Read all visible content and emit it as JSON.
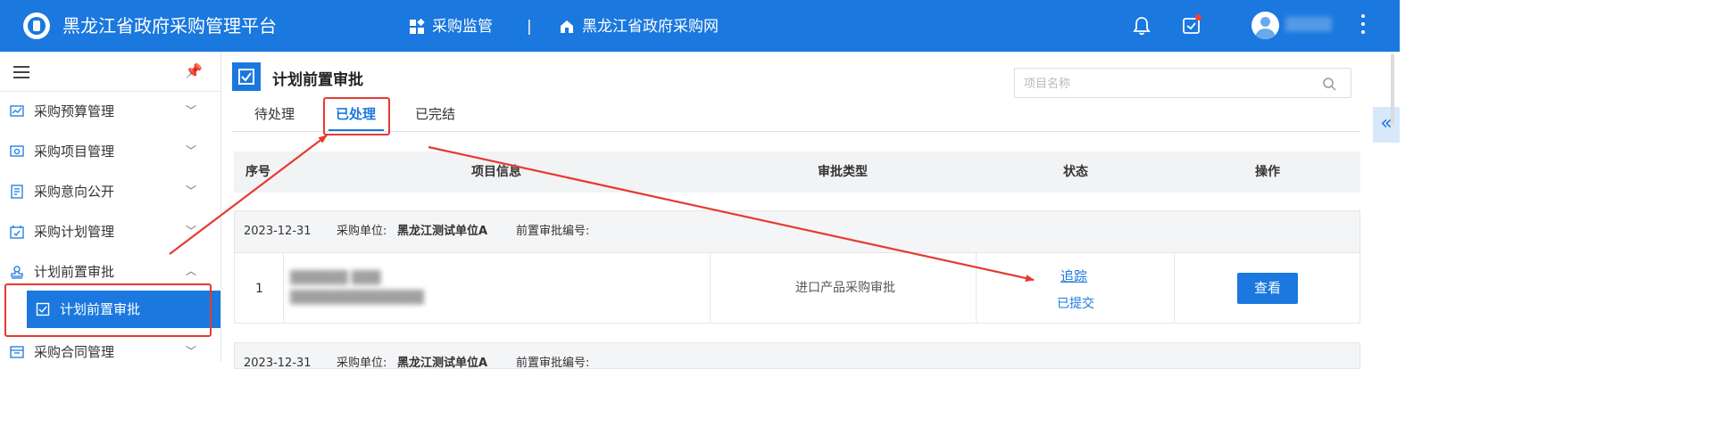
{
  "app": {
    "title": "黑龙江省政府采购管理平台",
    "nav": [
      {
        "label": "采购监管",
        "icon": "grid-icon"
      },
      {
        "label": "黑龙江省政府采购网",
        "icon": "home-icon"
      }
    ],
    "nav_separator": "|",
    "user": {
      "name": "██████"
    }
  },
  "sidebar": {
    "items": [
      {
        "label": "采购预算管理",
        "icon": "chart-icon",
        "expanded": false
      },
      {
        "label": "采购项目管理",
        "icon": "monitor-icon",
        "expanded": false
      },
      {
        "label": "采购意向公开",
        "icon": "document-icon",
        "expanded": false
      },
      {
        "label": "采购计划管理",
        "icon": "calendar-icon",
        "expanded": false
      },
      {
        "label": "计划前置审批",
        "icon": "stamp-icon",
        "expanded": true
      },
      {
        "label": "采购合同管理",
        "icon": "contract-icon",
        "expanded": false
      }
    ],
    "active_sub": {
      "label": "计划前置审批",
      "icon": "approval-icon"
    }
  },
  "page": {
    "title": "计划前置审批",
    "search_placeholder": "项目名称",
    "tabs": [
      "待处理",
      "已处理",
      "已完结"
    ],
    "active_tab": "已处理"
  },
  "table": {
    "columns": [
      "序号",
      "项目信息",
      "审批类型",
      "状态",
      "操作"
    ],
    "groups": [
      {
        "date": "2023-12-31",
        "unit_label": "采购单位:",
        "unit": "黑龙江测试单位A",
        "code_label": "前置审批编号:",
        "code": "",
        "rows": [
          {
            "index": "1",
            "info_line1": "██████ ███",
            "info_line2": "████████████████",
            "approval_type": "进口产品采购审批",
            "track": "追踪",
            "status": "已提交",
            "action": "查看"
          }
        ]
      },
      {
        "date": "2023-12-31",
        "unit_label": "采购单位:",
        "unit": "黑龙江测试单位A",
        "code_label": "前置审批编号:"
      }
    ]
  },
  "colors": {
    "primary": "#1a78de",
    "annotation": "#e63a32",
    "header_bg": "#f2f3f5"
  }
}
